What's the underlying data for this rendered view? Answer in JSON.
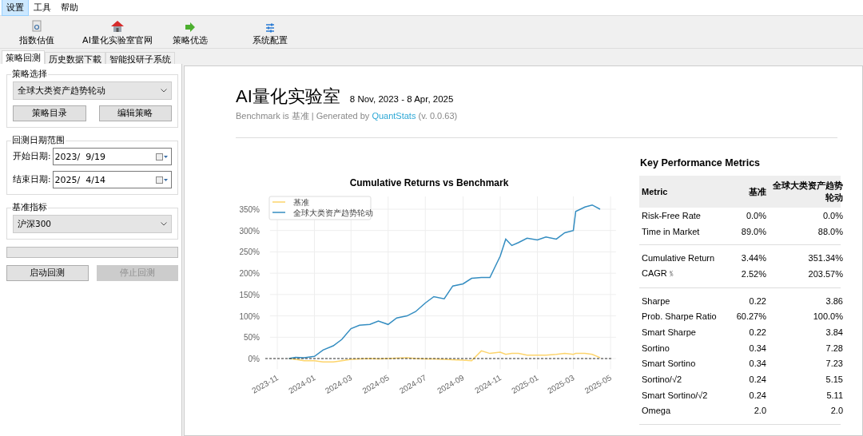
{
  "menu": [
    {
      "label": "设置",
      "selected": true
    },
    {
      "label": "工具",
      "selected": false
    },
    {
      "label": "帮助",
      "selected": false
    }
  ],
  "toolbar": [
    {
      "label": "指数估值",
      "kind": "magnifier"
    },
    {
      "label": "AI量化实验室官网",
      "kind": "house"
    },
    {
      "label": "策略优选",
      "kind": "arrow"
    },
    {
      "label": "系统配置",
      "kind": "sliders"
    }
  ],
  "tabs": [
    {
      "label": "策略回测",
      "selected": true
    },
    {
      "label": "历史数据下載",
      "selected": false
    },
    {
      "label": "智能投研子系统",
      "selected": false
    }
  ],
  "strategy_group": {
    "title": "策略选择",
    "dropdown": "全球大类资产趋势轮动",
    "buttons": [
      {
        "label": "策略目录",
        "disabled": false
      },
      {
        "label": "编辑策略",
        "disabled": false
      }
    ]
  },
  "date_group": {
    "title": "回测日期范围",
    "fields": [
      {
        "label": "开始日期:",
        "value": "2023/  9/19"
      },
      {
        "label": "结束日期:",
        "value": "2025/  4/14"
      }
    ]
  },
  "benchmark_group": {
    "title": "基准指标",
    "dropdown": "沪深300"
  },
  "progress": {
    "level": 0
  },
  "actions": [
    {
      "label": "启动回测",
      "disabled": false
    },
    {
      "label": "停止回测",
      "disabled": true
    }
  ],
  "report": {
    "title": "AI量化实验室",
    "date_range": "8 Nov, 2023 - 8 Apr, 2025",
    "subtitle_prefix": "Benchmark is 基准 | Generated by ",
    "subtitle_link": "QuantStats",
    "subtitle_suffix": " (v. 0.0.63)",
    "chart": {
      "chart_data": {
        "type": "line",
        "title": "Cumulative Returns vs Benchmark",
        "x": [
          "2023-11-20",
          "2023-12-01",
          "2023-12-15",
          "2024-01-01",
          "2024-01-15",
          "2024-02-01",
          "2024-02-15",
          "2024-03-01",
          "2024-03-15",
          "2024-04-01",
          "2024-04-15",
          "2024-05-01",
          "2024-05-15",
          "2024-06-01",
          "2024-06-15",
          "2024-07-01",
          "2024-07-15",
          "2024-08-01",
          "2024-08-15",
          "2024-09-01",
          "2024-09-15",
          "2024-10-01",
          "2024-10-15",
          "2024-11-01",
          "2024-11-10",
          "2024-11-20",
          "2024-12-01",
          "2024-12-15",
          "2025-01-01",
          "2025-01-15",
          "2025-02-01",
          "2025-02-15",
          "2025-03-01",
          "2025-03-05",
          "2025-03-20",
          "2025-04-01",
          "2025-04-14"
        ],
        "series": [
          {
            "name": "基准",
            "color": "#fdd46b",
            "values": [
              0,
              -2,
              -5,
              -5,
              -8,
              -8,
              -5,
              -2,
              -1,
              0,
              -1,
              0,
              1,
              2,
              0,
              -1,
              -1,
              -2,
              -3,
              -4,
              -5,
              18,
              12,
              15,
              10,
              12,
              12,
              8,
              8,
              8,
              10,
              12,
              10,
              12,
              12,
              10,
              2
            ]
          },
          {
            "name": "全球大类资产趋势轮动",
            "color": "#348dc1",
            "values": [
              0,
              3,
              2,
              5,
              20,
              30,
              45,
              70,
              78,
              80,
              88,
              80,
              95,
              100,
              110,
              130,
              145,
              140,
              170,
              175,
              188,
              190,
              190,
              240,
              280,
              265,
              272,
              282,
              278,
              285,
              280,
              295,
              300,
              345,
              355,
              360,
              350
            ]
          }
        ],
        "xticks": [
          {
            "value": "2023-11-01",
            "label": "2023-11"
          },
          {
            "value": "2024-01-01",
            "label": "2024-01"
          },
          {
            "value": "2024-03-01",
            "label": "2024-03"
          },
          {
            "value": "2024-05-01",
            "label": "2024-05"
          },
          {
            "value": "2024-07-01",
            "label": "2024-07"
          },
          {
            "value": "2024-09-01",
            "label": "2024-09"
          },
          {
            "value": "2024-11-01",
            "label": "2024-11"
          },
          {
            "value": "2025-01-01",
            "label": "2025-01"
          },
          {
            "value": "2025-03-01",
            "label": "2025-03"
          },
          {
            "value": "2025-05-01",
            "label": "2025-05"
          }
        ],
        "xlim": [
          "2023-10-20",
          "2025-05-10"
        ],
        "ylim": [
          -25,
          380
        ],
        "grid": true,
        "legend": true,
        "ref_lines": [
          {
            "axis": "y",
            "value": 0
          }
        ],
        "yticks": [
          {
            "value": 0,
            "label": "0%"
          },
          {
            "value": 50,
            "label": "50%"
          },
          {
            "value": 100,
            "label": "100%"
          },
          {
            "value": 150,
            "label": "150%"
          },
          {
            "value": 200,
            "label": "200%"
          },
          {
            "value": 250,
            "label": "250%"
          },
          {
            "value": 300,
            "label": "300%"
          },
          {
            "value": 350,
            "label": "350%"
          }
        ]
      }
    },
    "metrics": {
      "title": "Key Performance Metrics",
      "columns": [
        "Metric",
        "基准",
        "全球大类资产趋势轮动"
      ],
      "groups": [
        [
          {
            "metric": "Risk-Free Rate",
            "benchmark": "0.0%",
            "strategy": "0.0%"
          },
          {
            "metric": "Time in Market",
            "benchmark": "89.0%",
            "strategy": "88.0%"
          }
        ],
        [
          {
            "metric": "Cumulative Return",
            "benchmark": "3.44%",
            "strategy": "351.34%"
          },
          {
            "metric": "CAGR﹪",
            "benchmark": "2.52%",
            "strategy": "203.57%"
          }
        ],
        [
          {
            "metric": "Sharpe",
            "benchmark": "0.22",
            "strategy": "3.86"
          },
          {
            "metric": "Prob. Sharpe Ratio",
            "benchmark": "60.27%",
            "strategy": "100.0%"
          },
          {
            "metric": "Smart Sharpe",
            "benchmark": "0.22",
            "strategy": "3.84"
          },
          {
            "metric": "Sortino",
            "benchmark": "0.34",
            "strategy": "7.28"
          },
          {
            "metric": "Smart Sortino",
            "benchmark": "0.34",
            "strategy": "7.23"
          },
          {
            "metric": "Sortino/√2",
            "benchmark": "0.24",
            "strategy": "5.15"
          },
          {
            "metric": "Smart Sortino/√2",
            "benchmark": "0.24",
            "strategy": "5.11"
          },
          {
            "metric": "Omega",
            "benchmark": "2.0",
            "strategy": "2.0"
          }
        ]
      ]
    }
  }
}
